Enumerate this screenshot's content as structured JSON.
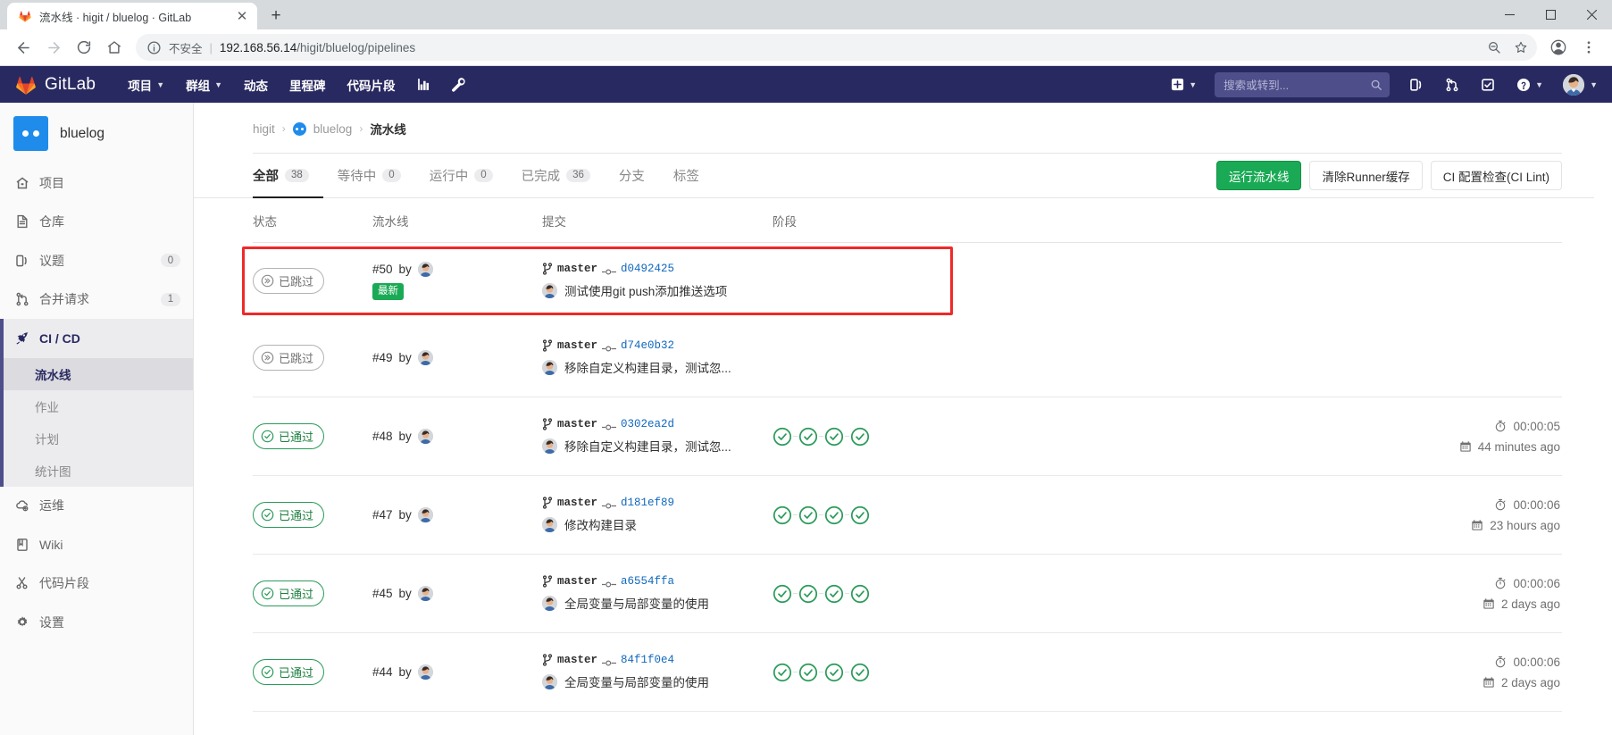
{
  "browser": {
    "tab_title": "流水线 · higit / bluelog · GitLab",
    "tab_close": "✕",
    "new_tab": "+",
    "nav": {
      "back": "←",
      "forward": "→",
      "reload": "⟳",
      "home": "⌂"
    },
    "omnibox": {
      "security_text": "不安全",
      "separator": "|",
      "url_host": "192.168.56.14",
      "url_path": "/higit/bluelog/pipelines"
    },
    "window": {
      "minimize": "—",
      "maximize": "▢",
      "close": "✕"
    }
  },
  "gitlab_nav": {
    "brand": "GitLab",
    "menu": [
      {
        "label": "项目",
        "has_caret": true
      },
      {
        "label": "群组",
        "has_caret": true
      },
      {
        "label": "动态",
        "has_caret": false
      },
      {
        "label": "里程碑",
        "has_caret": false
      },
      {
        "label": "代码片段",
        "has_caret": false
      }
    ],
    "search_placeholder": "搜索或转到...",
    "icons": [
      "chart-icon",
      "wrench-icon",
      "plus-icon",
      "issues-icon",
      "merge-requests-icon",
      "todos-icon",
      "help-icon"
    ]
  },
  "sidebar": {
    "project_name": "bluelog",
    "items": [
      {
        "label": "项目",
        "icon": "home-icon",
        "badge": null
      },
      {
        "label": "仓库",
        "icon": "document-icon",
        "badge": null
      },
      {
        "label": "议题",
        "icon": "issues-icon",
        "badge": "0"
      },
      {
        "label": "合并请求",
        "icon": "merge-request-icon",
        "badge": "1"
      },
      {
        "label": "CI / CD",
        "icon": "rocket-icon",
        "badge": null,
        "active": true
      },
      {
        "label": "运维",
        "icon": "cloud-gear-icon",
        "badge": null
      },
      {
        "label": "Wiki",
        "icon": "book-icon",
        "badge": null
      },
      {
        "label": "代码片段",
        "icon": "snippet-icon",
        "badge": null
      },
      {
        "label": "设置",
        "icon": "gear-icon",
        "badge": null
      }
    ],
    "subitems": [
      {
        "label": "流水线",
        "current": true
      },
      {
        "label": "作业",
        "current": false
      },
      {
        "label": "计划",
        "current": false
      },
      {
        "label": "统计图",
        "current": false
      }
    ]
  },
  "breadcrumb": {
    "group": "higit",
    "project": "bluelog",
    "current": "流水线",
    "separator": "›"
  },
  "tabs": [
    {
      "label": "全部",
      "count": "38",
      "selected": true
    },
    {
      "label": "等待中",
      "count": "0",
      "selected": false
    },
    {
      "label": "运行中",
      "count": "0",
      "selected": false
    },
    {
      "label": "已完成",
      "count": "36",
      "selected": false
    },
    {
      "label": "分支",
      "count": null,
      "selected": false
    },
    {
      "label": "标签",
      "count": null,
      "selected": false
    }
  ],
  "actions": {
    "run_pipeline": "运行流水线",
    "clear_runner_cache": "清除Runner缓存",
    "ci_lint": "CI 配置检查(CI Lint)"
  },
  "table": {
    "headers": {
      "status": "状态",
      "pipeline": "流水线",
      "commit": "提交",
      "stages": "阶段",
      "time": ""
    },
    "rows": [
      {
        "status": {
          "label": "已跳过",
          "type": "skipped"
        },
        "pipeline_id": "#50",
        "by_label": "by",
        "tag": "最新",
        "branch": "master",
        "sha": "d0492425",
        "message": "测试使用git push添加推送选项",
        "stages": [],
        "duration": null,
        "finished": null,
        "highlighted": true
      },
      {
        "status": {
          "label": "已跳过",
          "type": "skipped"
        },
        "pipeline_id": "#49",
        "by_label": "by",
        "tag": null,
        "branch": "master",
        "sha": "d74e0b32",
        "message": "移除自定义构建目录，测试忽...",
        "stages": [],
        "duration": null,
        "finished": null,
        "highlighted": false
      },
      {
        "status": {
          "label": "已通过",
          "type": "passed"
        },
        "pipeline_id": "#48",
        "by_label": "by",
        "tag": null,
        "branch": "master",
        "sha": "0302ea2d",
        "message": "移除自定义构建目录，测试忽...",
        "stages": [
          "passed",
          "passed",
          "passed",
          "passed"
        ],
        "duration": "00:00:05",
        "finished": "44 minutes ago",
        "highlighted": false
      },
      {
        "status": {
          "label": "已通过",
          "type": "passed"
        },
        "pipeline_id": "#47",
        "by_label": "by",
        "tag": null,
        "branch": "master",
        "sha": "d181ef89",
        "message": "修改构建目录",
        "stages": [
          "passed",
          "passed",
          "passed",
          "passed"
        ],
        "duration": "00:00:06",
        "finished": "23 hours ago",
        "highlighted": false
      },
      {
        "status": {
          "label": "已通过",
          "type": "passed"
        },
        "pipeline_id": "#45",
        "by_label": "by",
        "tag": null,
        "branch": "master",
        "sha": "a6554ffa",
        "message": "全局变量与局部变量的使用",
        "stages": [
          "passed",
          "passed",
          "passed",
          "passed"
        ],
        "duration": "00:00:06",
        "finished": "2 days ago",
        "highlighted": false
      },
      {
        "status": {
          "label": "已通过",
          "type": "passed"
        },
        "pipeline_id": "#44",
        "by_label": "by",
        "tag": null,
        "branch": "master",
        "sha": "84f1f0e4",
        "message": "全局变量与局部变量的使用",
        "stages": [
          "passed",
          "passed",
          "passed",
          "passed"
        ],
        "duration": "00:00:06",
        "finished": "2 days ago",
        "highlighted": false
      }
    ]
  },
  "colors": {
    "gitlab_navy": "#292961",
    "green": "#1aaa55",
    "link_blue": "#1068bf",
    "highlight_red": "#ef2929",
    "project_avatar": "#1f8ceb"
  }
}
